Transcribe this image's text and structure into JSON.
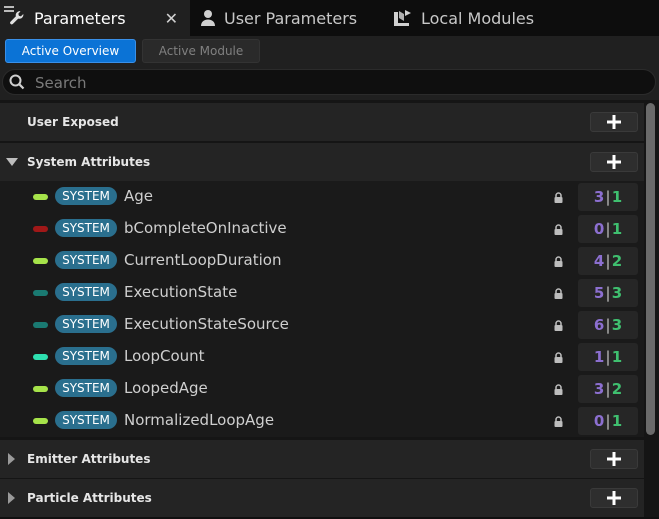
{
  "tabs": {
    "parameters": "Parameters",
    "user_parameters": "User Parameters",
    "local_modules": "Local Modules",
    "close": "✕"
  },
  "toolbar": {
    "active_overview": "Active Overview",
    "active_module": "Active Module"
  },
  "search": {
    "placeholder": "Search"
  },
  "sections": {
    "user_exposed": "User Exposed",
    "system_attributes": "System Attributes",
    "emitter_attributes": "Emitter Attributes",
    "particle_attributes": "Particle Attributes"
  },
  "rows": [
    {
      "badge": "SYSTEM",
      "name": "Age",
      "a": "3",
      "sep": "|",
      "b": "1",
      "pin_color": "#a6e34a"
    },
    {
      "badge": "SYSTEM",
      "name": "bCompleteOnInactive",
      "a": "0",
      "sep": "|",
      "b": "1",
      "pin_color": "#a01818"
    },
    {
      "badge": "SYSTEM",
      "name": "CurrentLoopDuration",
      "a": "4",
      "sep": "|",
      "b": "2",
      "pin_color": "#a6e34a"
    },
    {
      "badge": "SYSTEM",
      "name": "ExecutionState",
      "a": "5",
      "sep": "|",
      "b": "3",
      "pin_color": "#1a7a72"
    },
    {
      "badge": "SYSTEM",
      "name": "ExecutionStateSource",
      "a": "6",
      "sep": "|",
      "b": "3",
      "pin_color": "#1a7a72"
    },
    {
      "badge": "SYSTEM",
      "name": "LoopCount",
      "a": "1",
      "sep": "|",
      "b": "1",
      "pin_color": "#2ee0b0"
    },
    {
      "badge": "SYSTEM",
      "name": "LoopedAge",
      "a": "3",
      "sep": "|",
      "b": "2",
      "pin_color": "#a6e34a"
    },
    {
      "badge": "SYSTEM",
      "name": "NormalizedLoopAge",
      "a": "0",
      "sep": "|",
      "b": "1",
      "pin_color": "#a6e34a"
    }
  ],
  "colors": {
    "accent": "#0b73d6",
    "badge": "#2a6f8e",
    "count_a": "#8c6fd0",
    "count_b": "#3fbf6f"
  }
}
